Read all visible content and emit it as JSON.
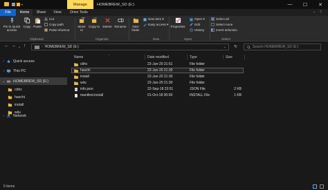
{
  "window": {
    "manage_tab": "Manage",
    "title": "HOMEBREW_SD (E:)",
    "minimize": "—",
    "maximize": "☐",
    "close": "✕"
  },
  "ribbon_tabs": [
    "File",
    "Home",
    "Share",
    "View",
    "Drive Tools"
  ],
  "ribbon": {
    "clipboard": {
      "pin": "Pin to Quick access",
      "copy": "Copy",
      "paste": "Paste",
      "cut": "Cut",
      "copy_path": "Copy path",
      "paste_shortcut": "Paste shortcut",
      "label": "Clipboard"
    },
    "organize": {
      "move_to": "Move to",
      "copy_to": "Copy to",
      "delete": "Delete",
      "rename": "Rename",
      "label": "Organize"
    },
    "new": {
      "new_folder": "New folder",
      "new_item": "New item ▾",
      "easy_access": "Easy access ▾",
      "label": "New"
    },
    "open": {
      "properties": "Properties",
      "open": "Open ▾",
      "edit": "Edit",
      "history": "History",
      "label": "Open"
    },
    "select": {
      "select_all": "Select all",
      "select_none": "Select none",
      "invert_selection": "Invert selection",
      "label": "Select"
    }
  },
  "nav": {
    "back": "←",
    "forward": "→",
    "up_list": "⌄",
    "up": "↑",
    "address": "HOMEBREW_SD (E:)",
    "address_chevron": "›",
    "address_dropdown": "⌄",
    "refresh": "↻",
    "search_placeholder": "Search HOMEBREW_SD (E:)"
  },
  "sidebar": [
    {
      "label": "Quick access",
      "chev": "›"
    },
    {
      "label": "This PC",
      "chev": "›"
    },
    {
      "label": "HOMEBREW_SD (E:)",
      "chev": "⌄"
    },
    {
      "label": "cbhc",
      "chev": ""
    },
    {
      "label": "haxchi",
      "chev": ""
    },
    {
      "label": "install",
      "chev": ""
    },
    {
      "label": "wiiu",
      "chev": ""
    },
    {
      "label": "Network",
      "chev": "›"
    }
  ],
  "columns": {
    "name": "Name",
    "date": "Date modified",
    "type": "Type",
    "size": "Size",
    "sort_caret": "^"
  },
  "files": [
    {
      "name": "cbhc",
      "date": "22-Jun-20 21:51",
      "type": "File folder",
      "size": ""
    },
    {
      "name": "haxchi",
      "date": "22-Jun-20 21:30",
      "type": "File folder",
      "size": ""
    },
    {
      "name": "install",
      "date": "22-Jun-20 21:30",
      "type": "File folder",
      "size": ""
    },
    {
      "name": "wiiu",
      "date": "22-Jun-20 21:30",
      "type": "File folder",
      "size": ""
    },
    {
      "name": "info.json",
      "date": "22-Sep-18 23:51",
      "type": "JSON File",
      "size": "2 KB"
    },
    {
      "name": "manifest.install",
      "date": "01-Oct-18 00:09",
      "type": "INSTALL File",
      "size": "1 KB"
    }
  ],
  "status": {
    "items": "6 items"
  },
  "colors": {
    "accent": "#1564c8",
    "manage": "#ffd95a",
    "folder": "#e8b84a",
    "background": "#191919"
  }
}
